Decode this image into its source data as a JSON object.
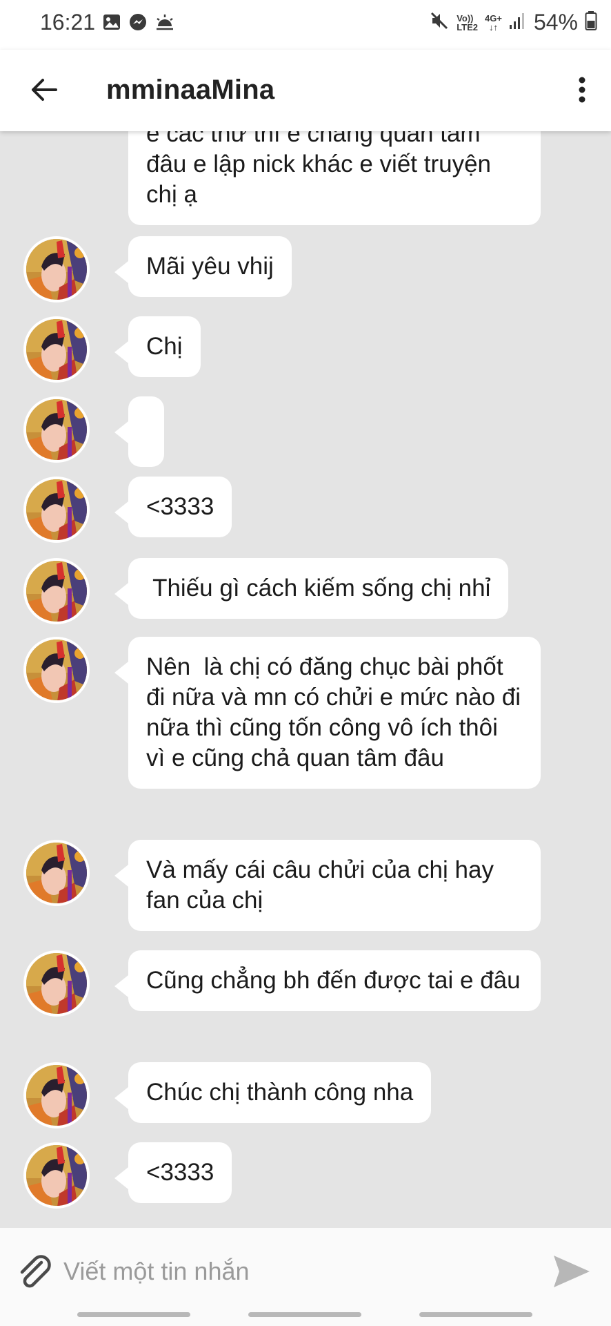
{
  "status_bar": {
    "time": "16:21",
    "battery_percent": "54%",
    "network_label_top": "Vo))",
    "network_label_bottom": "LTE2",
    "network_type": "4G+",
    "icons_left": [
      "gallery-icon",
      "messenger-icon",
      "weather-icon"
    ],
    "icons_right": [
      "mute-icon",
      "volte-icon",
      "data-arrows-icon",
      "signal-icon",
      "battery-icon"
    ]
  },
  "header": {
    "title": "mminaaMina",
    "back_icon": "back-arrow-icon",
    "more_icon": "more-vertical-icon"
  },
  "messages": [
    {
      "text": "e các thứ thì e chẳng quan tâm đâu e lập nick khác e viết truyện chị ạ",
      "avatar": false,
      "partially_hidden": true
    },
    {
      "text": "Mãi yêu vhij",
      "avatar": true
    },
    {
      "text": "Chị",
      "avatar": true
    },
    {
      "text": "",
      "avatar": true
    },
    {
      "text": "<3333",
      "avatar": true
    },
    {
      "text": " Thiếu gì cách kiếm sống chị nhỉ",
      "avatar": true
    },
    {
      "text": "Nên  là chị có đăng chục bài phốt đi nữa và mn có chửi e mức nào đi nữa thì cũng tốn công vô ích thôi vì e cũng chả quan tâm đâu",
      "avatar": true
    },
    {
      "text": "Và mấy cái câu chửi của chị hay fan của chị",
      "avatar": true
    },
    {
      "text": "Cũng chẳng bh đến được tai e đâu",
      "avatar": true
    },
    {
      "text": "Chúc chị thành công nha",
      "avatar": true
    },
    {
      "text": "<3333",
      "avatar": true
    }
  ],
  "composer": {
    "placeholder": "Viết một tin nhắn",
    "value": "",
    "attach_icon": "paperclip-icon",
    "send_icon": "send-icon"
  },
  "colors": {
    "chat_background": "#e4e4e4",
    "bubble": "#ffffff",
    "header": "#ffffff",
    "text": "#1b1b1b"
  }
}
